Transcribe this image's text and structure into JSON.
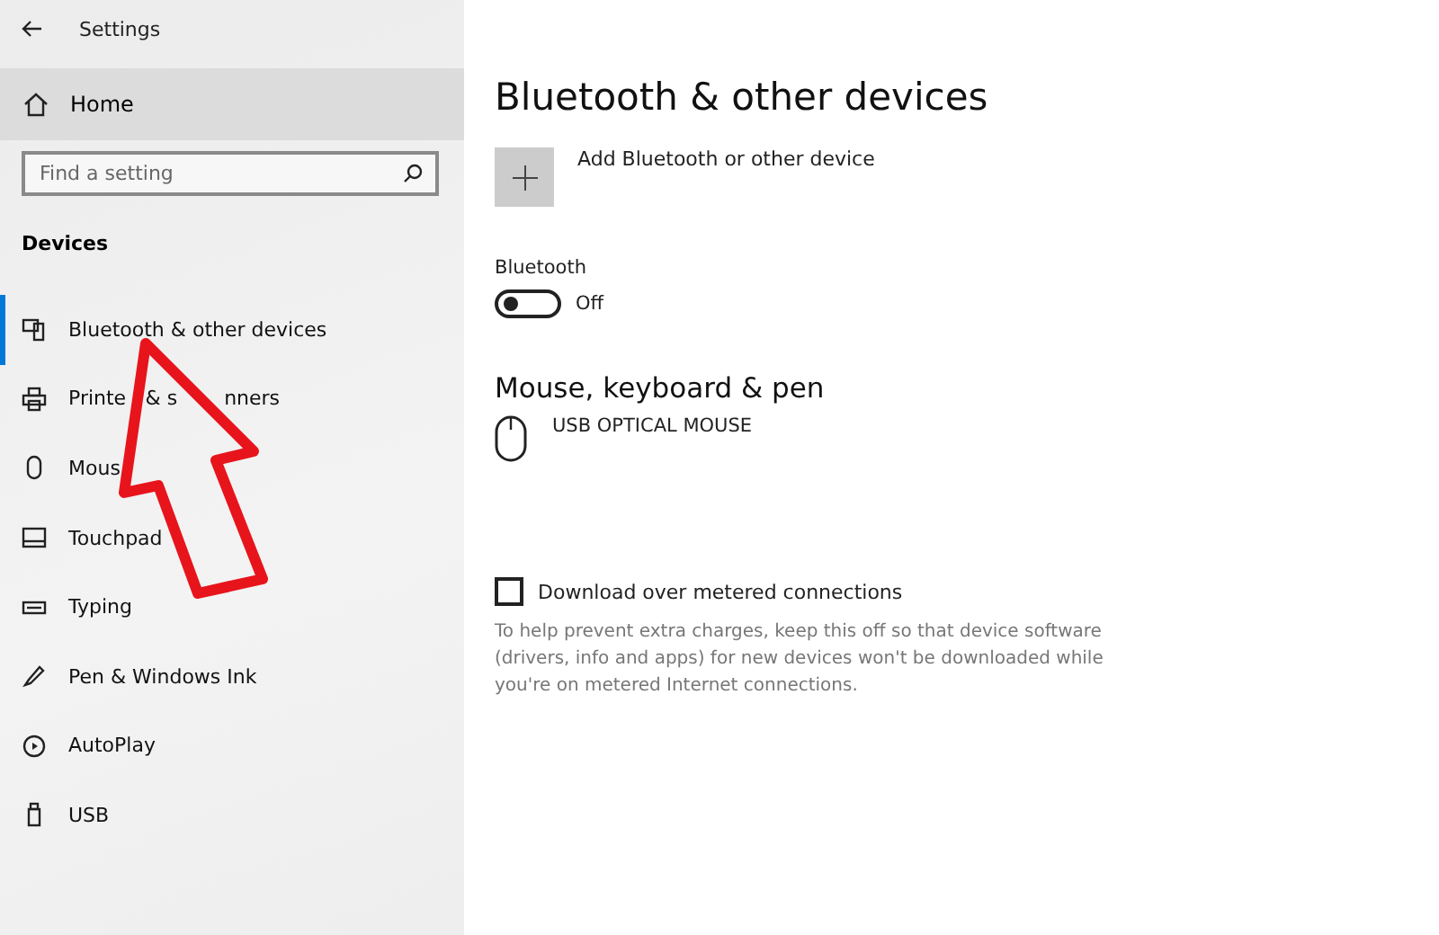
{
  "window": {
    "title": "Settings"
  },
  "sidebar": {
    "home": {
      "label": "Home",
      "selected": false
    },
    "search": {
      "placeholder": "Find a setting"
    },
    "section": "Devices",
    "items": [
      {
        "label_parts": [
          "Bluetooth & other devices"
        ],
        "selected": true
      },
      {
        "label_parts": [
          "Printe",
          "& s",
          "nners"
        ],
        "selected": false
      },
      {
        "label_parts": [
          "Mous"
        ],
        "selected": false
      },
      {
        "label_parts": [
          "Touchpad"
        ],
        "selected": false
      },
      {
        "label_parts": [
          "Typing"
        ],
        "selected": false
      },
      {
        "label_parts": [
          "Pen & Windows Ink"
        ],
        "selected": false
      },
      {
        "label_parts": [
          "AutoPlay"
        ],
        "selected": false
      },
      {
        "label_parts": [
          "USB"
        ],
        "selected": false
      }
    ]
  },
  "page": {
    "title": "Bluetooth & other devices",
    "add_button": {
      "label": "Add Bluetooth or other device"
    },
    "bluetooth": {
      "label": "Bluetooth",
      "on": false,
      "state_text": "Off"
    },
    "devices_heading": "Mouse, keyboard & pen",
    "devices": [
      {
        "name": "USB OPTICAL MOUSE"
      }
    ],
    "metered": {
      "label": "Download over metered connections",
      "checked": false,
      "description": "To help prevent extra charges, keep this off so that device software (drivers, info and apps) for new devices won't be downloaded while you're on metered Internet connections."
    }
  },
  "annotation": {
    "kind": "arrow"
  }
}
